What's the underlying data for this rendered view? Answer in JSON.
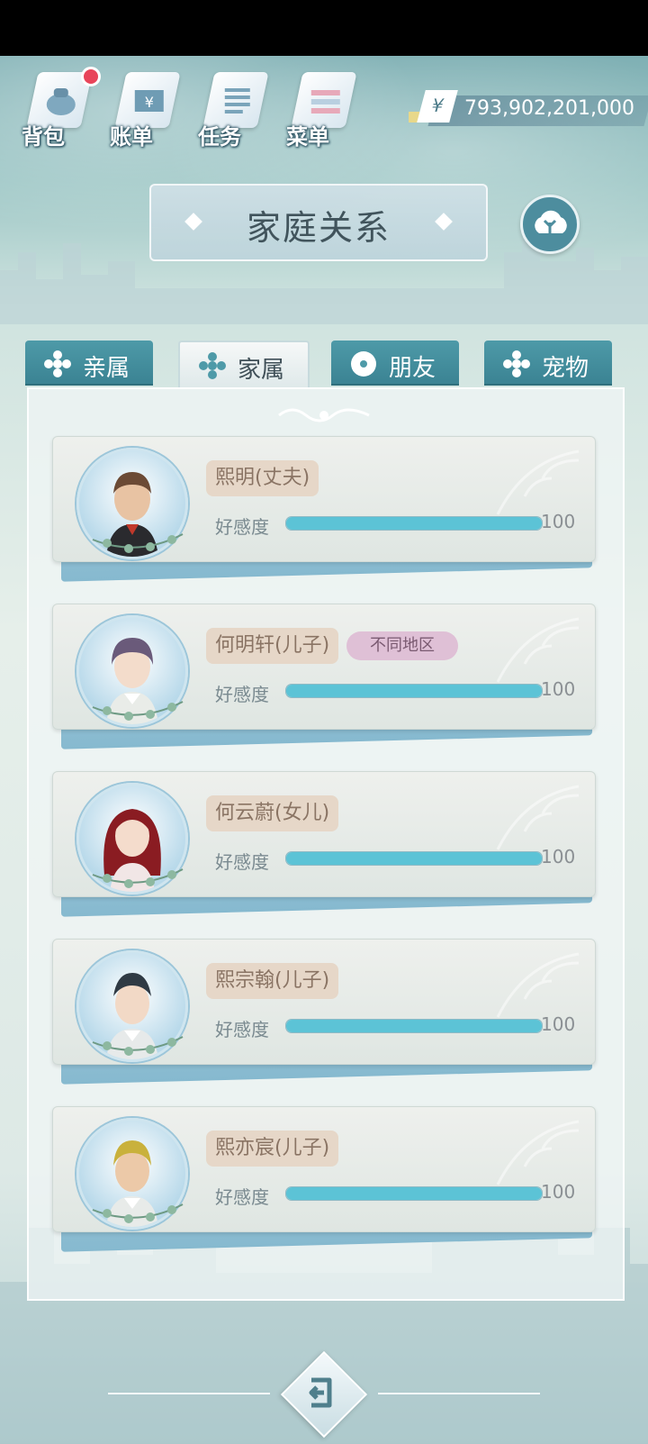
{
  "header": {
    "menu": [
      {
        "label": "背包",
        "icon": "bag-icon",
        "badge": true
      },
      {
        "label": "账单",
        "icon": "bill-icon",
        "badge": false
      },
      {
        "label": "任务",
        "icon": "task-icon",
        "badge": false
      },
      {
        "label": "菜单",
        "icon": "menu-icon",
        "badge": false
      }
    ],
    "money": {
      "symbol": "¥",
      "value": "793,902,201,000"
    }
  },
  "title": "家庭关系",
  "tabs": [
    {
      "label": "亲属",
      "active": false
    },
    {
      "label": "家属",
      "active": true
    },
    {
      "label": "朋友",
      "active": false
    },
    {
      "label": "宠物",
      "active": false
    }
  ],
  "affection_label": "好感度",
  "members": [
    {
      "name": "熙明(丈夫)",
      "affection": 100,
      "region_tag": ""
    },
    {
      "name": "何明轩(儿子)",
      "affection": 100,
      "region_tag": "不同地区"
    },
    {
      "name": "何云蔚(女儿)",
      "affection": 100,
      "region_tag": ""
    },
    {
      "name": "熙宗翰(儿子)",
      "affection": 100,
      "region_tag": ""
    },
    {
      "name": "熙亦宸(儿子)",
      "affection": 100,
      "region_tag": ""
    }
  ],
  "colors": {
    "accent": "#4e9aa8",
    "bar_fill": "#5cc3d6",
    "badge_red": "#e8455a",
    "name_tag": "#e6d7c8",
    "region_tag": "#dfc0d6"
  }
}
